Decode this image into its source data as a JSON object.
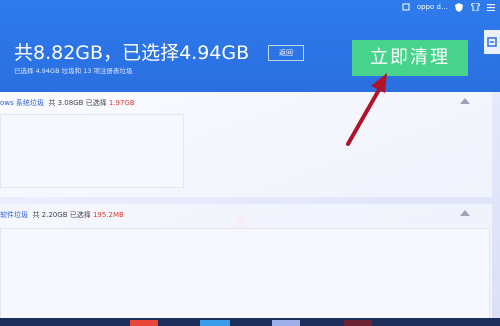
{
  "topbar": {
    "account": "oppo d…"
  },
  "header": {
    "total_text": "共8.82GB，已选择4.94GB",
    "back_label": "返回",
    "summary": "已选择 4.94GB 垃圾和 13 项注册表垃圾",
    "clean_button": "立即清理"
  },
  "sections": [
    {
      "name": "ows 系统垃圾",
      "info_prefix": "共 3.08GB 已选择",
      "selected": "1.97GB"
    },
    {
      "name": "软件垃圾",
      "info_prefix": "共 2.20GB 已选择",
      "selected": "195.2MB"
    }
  ],
  "colors": {
    "header": "#2e7bec",
    "clean_button": "#48d38c",
    "selected": "#e03a2a",
    "arrow": "#b0132b"
  }
}
